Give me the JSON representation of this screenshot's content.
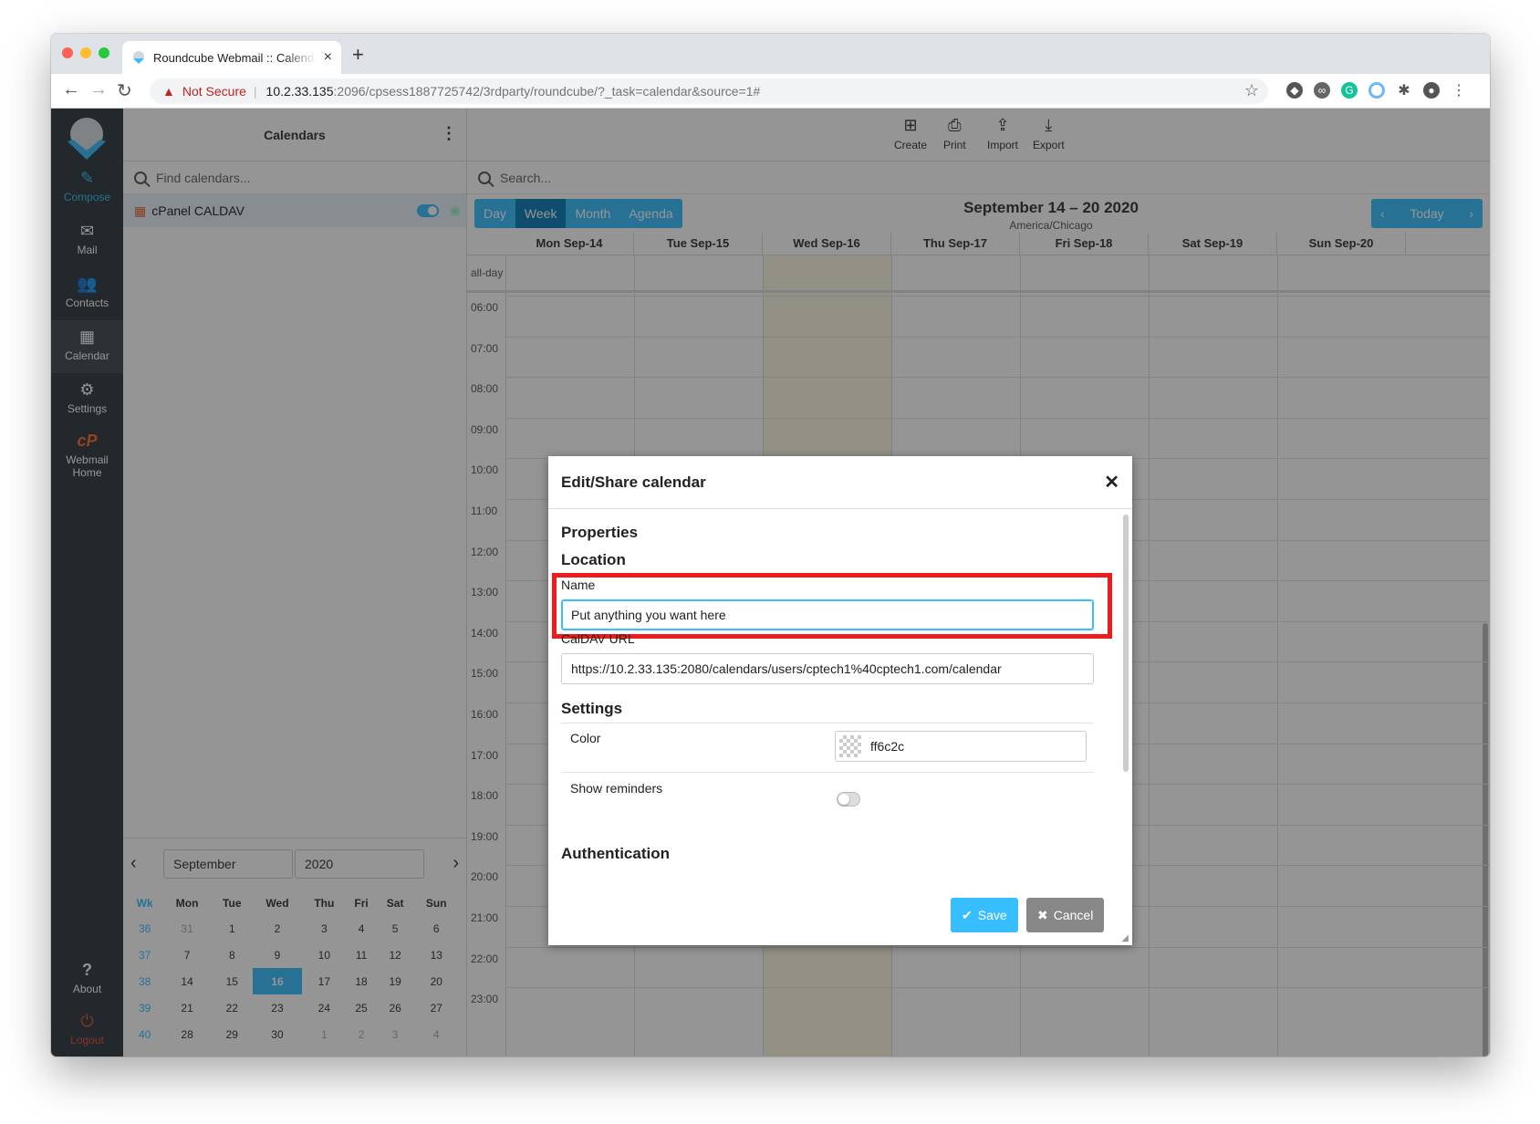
{
  "browser": {
    "tab_title": "Roundcube Webmail :: Calendar",
    "new_tab": "+",
    "tab_close": "×",
    "not_secure": "Not Secure",
    "url_host": "10.2.33.135",
    "url_path": ":2096/cpsess1887725742/3rdparty/roundcube/?_task=calendar&source=1#"
  },
  "nav": {
    "compose": "Compose",
    "mail": "Mail",
    "contacts": "Contacts",
    "calendar": "Calendar",
    "settings": "Settings",
    "webmail_home": "Webmail Home",
    "about": "About",
    "logout": "Logout"
  },
  "sidebar": {
    "title": "Calendars",
    "search_placeholder": "Find calendars...",
    "calendar_name": "cPanel CALDAV"
  },
  "minical": {
    "month": "September",
    "year": "2020",
    "headers": [
      "Wk",
      "Mon",
      "Tue",
      "Wed",
      "Thu",
      "Fri",
      "Sat",
      "Sun"
    ],
    "rows": [
      [
        "36",
        "31",
        "1",
        "2",
        "3",
        "4",
        "5",
        "6"
      ],
      [
        "37",
        "7",
        "8",
        "9",
        "10",
        "11",
        "12",
        "13"
      ],
      [
        "38",
        "14",
        "15",
        "16",
        "17",
        "18",
        "19",
        "20"
      ],
      [
        "39",
        "21",
        "22",
        "23",
        "24",
        "25",
        "26",
        "27"
      ],
      [
        "40",
        "28",
        "29",
        "30",
        "1",
        "2",
        "3",
        "4"
      ]
    ],
    "today": "16"
  },
  "toolbar": {
    "create": "Create",
    "print": "Print",
    "import": "Import",
    "export": "Export"
  },
  "calendar": {
    "search_placeholder": "Search...",
    "views": [
      "Day",
      "Week",
      "Month",
      "Agenda"
    ],
    "active_view": "Week",
    "range": "September 14 – 20 2020",
    "timezone": "America/Chicago",
    "today": "Today",
    "days": [
      "Mon Sep-14",
      "Tue Sep-15",
      "Wed Sep-16",
      "Thu Sep-17",
      "Fri Sep-18",
      "Sat Sep-19",
      "Sun Sep-20"
    ],
    "allday": "all-day",
    "hours": [
      "06:00",
      "07:00",
      "08:00",
      "09:00",
      "10:00",
      "11:00",
      "12:00",
      "13:00",
      "14:00",
      "15:00",
      "16:00",
      "17:00",
      "18:00",
      "19:00",
      "20:00",
      "21:00",
      "22:00",
      "23:00"
    ]
  },
  "dialog": {
    "title": "Edit/Share calendar",
    "properties": "Properties",
    "location": "Location",
    "name_label": "Name",
    "name_value": "Put anything you want here",
    "caldav_label": "CalDAV URL",
    "caldav_value": "https://10.2.33.135:2080/calendars/users/cptech1%40cptech1.com/calendar",
    "settings": "Settings",
    "color_label": "Color",
    "color_value": "ff6c2c",
    "reminders_label": "Show reminders",
    "authentication": "Authentication",
    "save": "Save",
    "cancel": "Cancel"
  },
  "colors": {
    "accent": "#37beff",
    "nav_bg": "#2f3a3f",
    "highlight": "#ec1c1c",
    "calendar_color": "#ff6c2c"
  }
}
